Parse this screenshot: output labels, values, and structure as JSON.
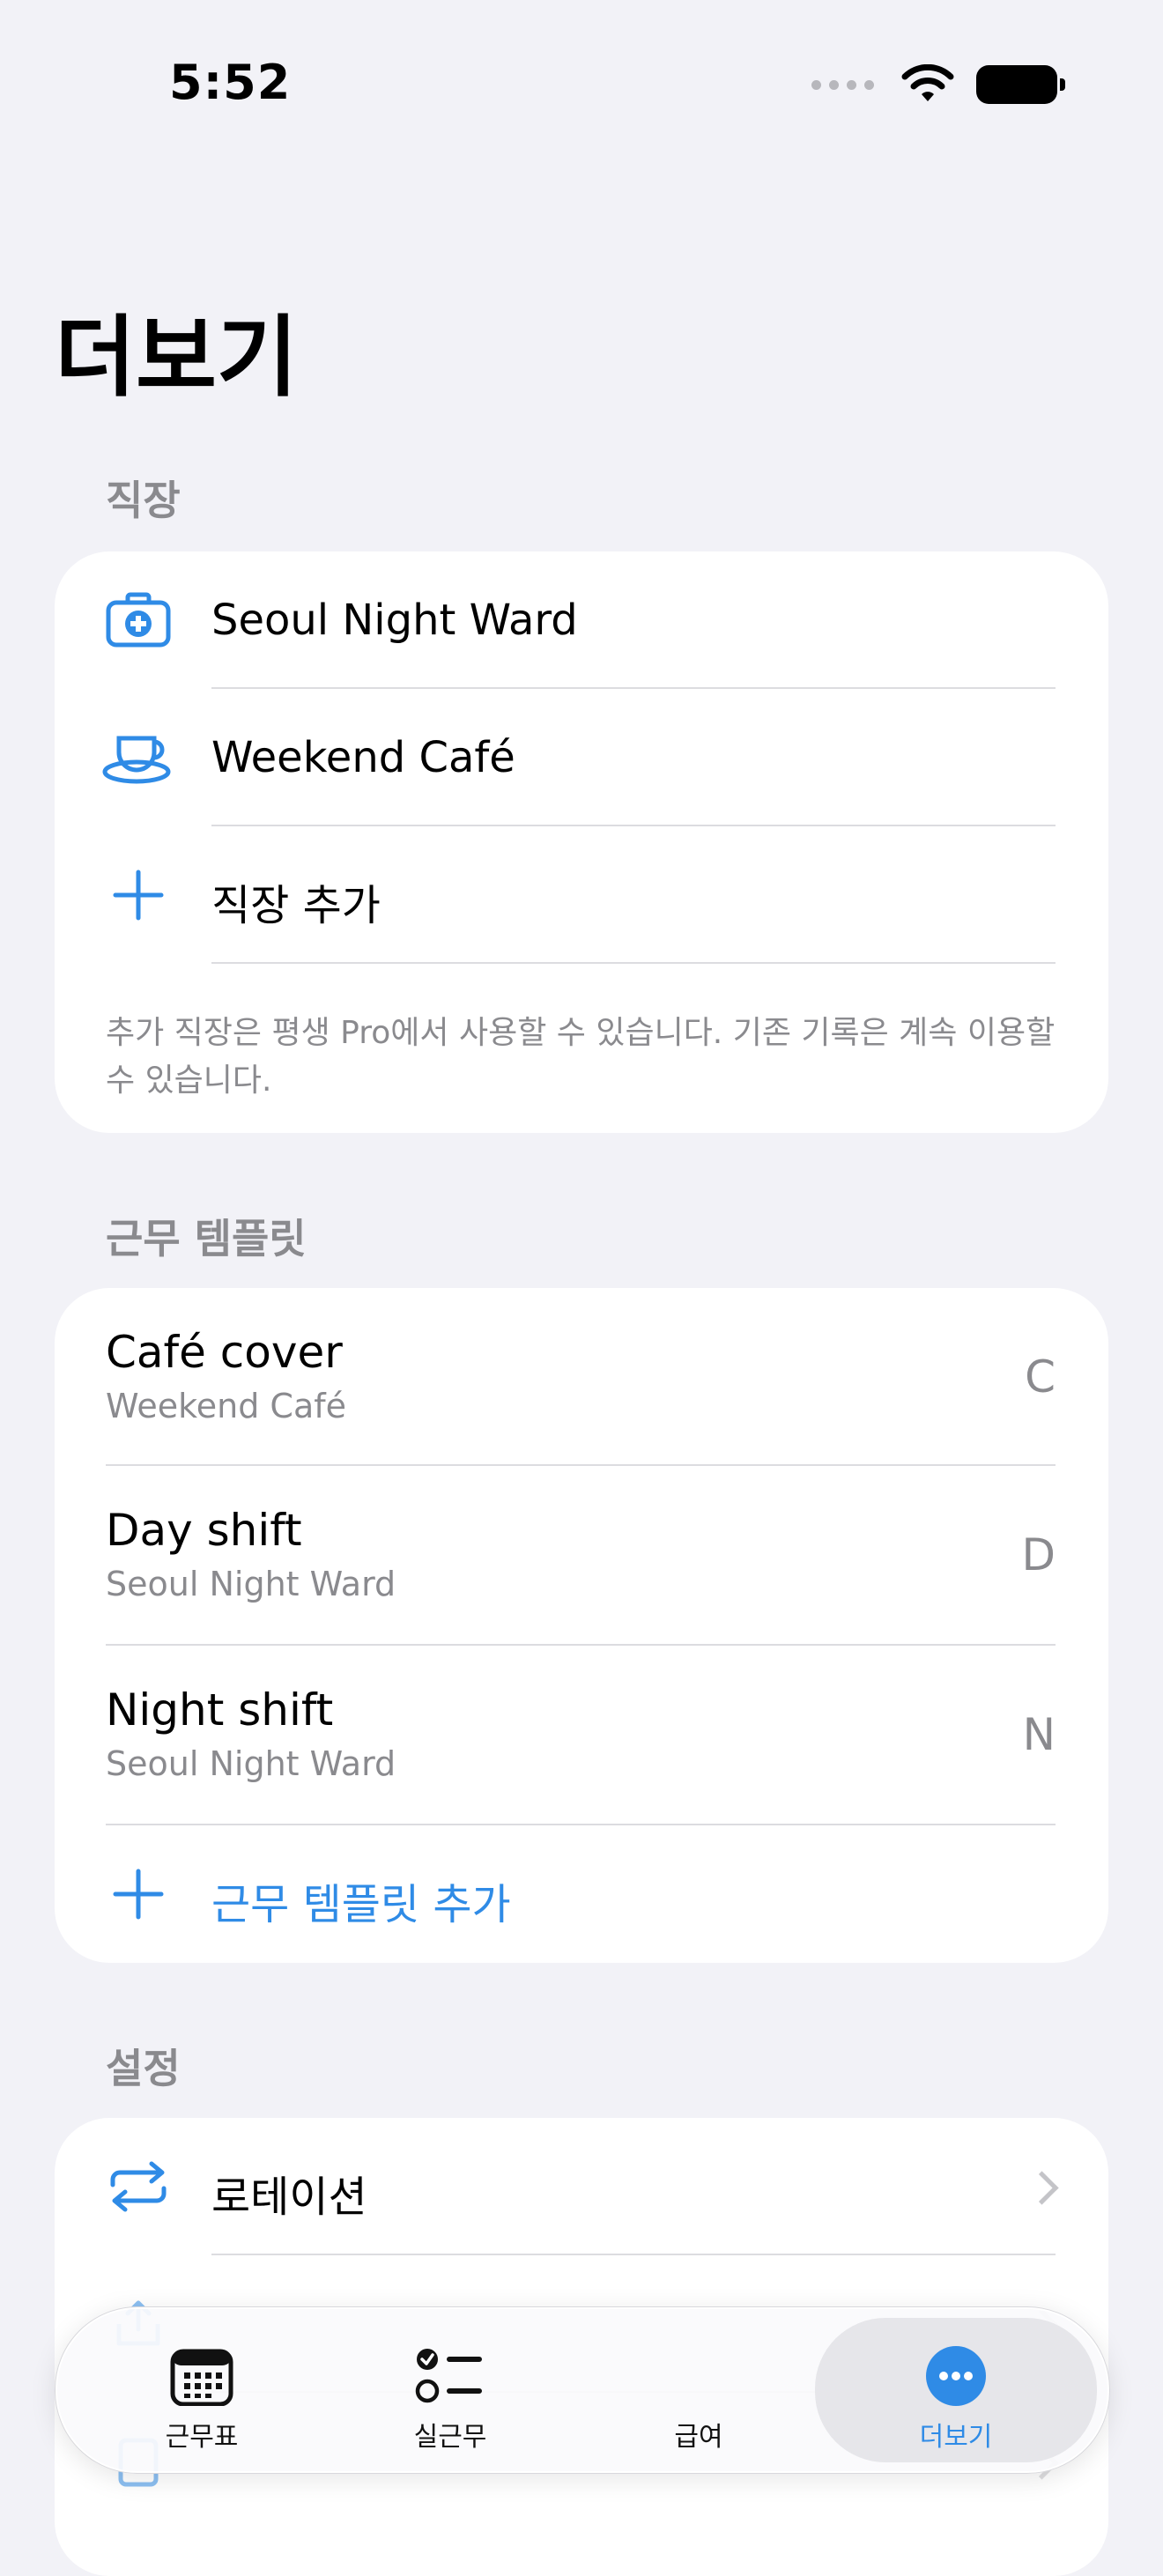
{
  "status_bar": {
    "time": "5:52"
  },
  "page_title": "더보기",
  "workplaces": {
    "header": "직장",
    "items": [
      {
        "label": "Seoul Night Ward",
        "icon": "medical-kit-icon"
      },
      {
        "label": "Weekend Café",
        "icon": "coffee-cup-icon"
      }
    ],
    "add_label": "직장 추가",
    "footnote": "추가 직장은 평생 Pro에서 사용할 수 있습니다. 기존 기록은 계속 이용할 수 있습니다."
  },
  "templates": {
    "header": "근무 템플릿",
    "items": [
      {
        "title": "Café cover",
        "workplace": "Weekend Café",
        "code": "C"
      },
      {
        "title": "Day shift",
        "workplace": "Seoul Night Ward",
        "code": "D"
      },
      {
        "title": "Night shift",
        "workplace": "Seoul Night Ward",
        "code": "N"
      }
    ],
    "add_label": "근무 템플릿 추가"
  },
  "settings": {
    "header": "설정",
    "items": [
      {
        "label": "로테이션",
        "icon": "rotation-icon"
      }
    ]
  },
  "tab_bar": {
    "tabs": [
      {
        "label": "근무표",
        "icon": "calendar-icon"
      },
      {
        "label": "실근무",
        "icon": "checklist-icon"
      },
      {
        "label": "급여",
        "icon": "payroll-icon"
      },
      {
        "label": "더보기",
        "icon": "more-icon",
        "active": true
      }
    ]
  },
  "colors": {
    "accent": "#2f8be6",
    "background": "#f2f2f7",
    "secondary_text": "#8a8a8e"
  }
}
